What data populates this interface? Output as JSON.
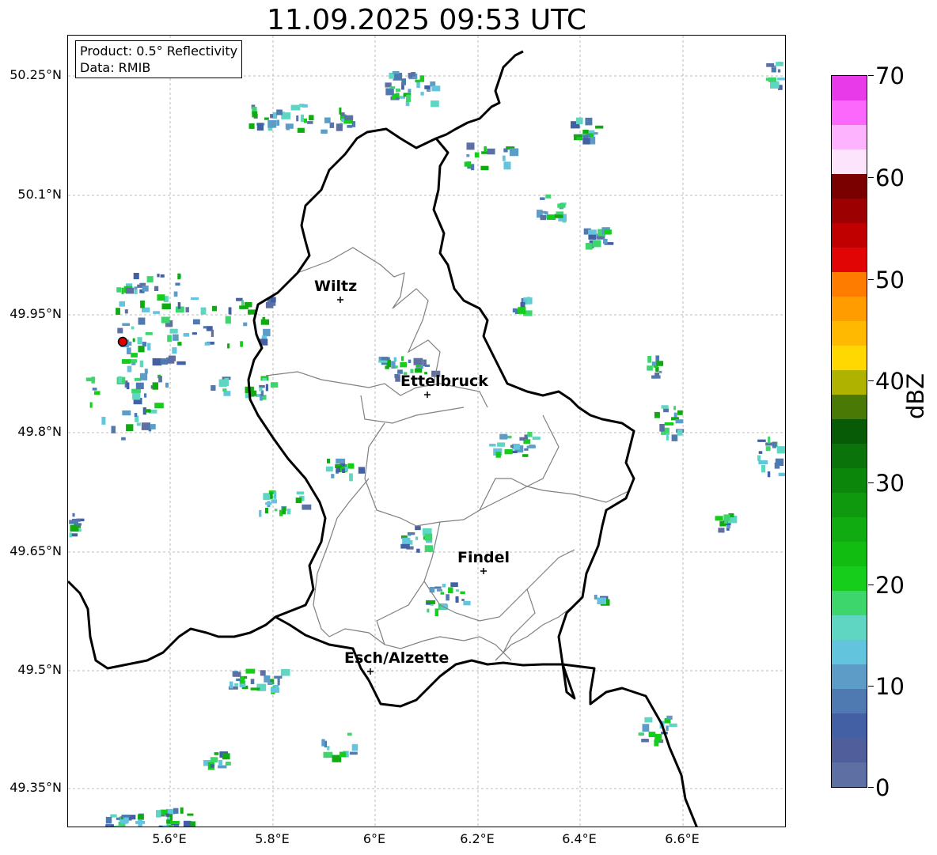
{
  "title": "11.09.2025 09:53 UTC",
  "infobox": {
    "product": "Product: 0.5° Reflectivity",
    "source": "Data: RMIB"
  },
  "axes": {
    "y_labels": [
      "50.25°N",
      "50.1°N",
      "49.95°N",
      "49.8°N",
      "49.65°N",
      "49.5°N",
      "49.35°N"
    ],
    "x_labels": [
      "5.6°E",
      "5.8°E",
      "6°E",
      "6.2°E",
      "6.4°E",
      "6.6°E"
    ]
  },
  "cities": [
    {
      "name": "Wiltz"
    },
    {
      "name": "Ettelbruck"
    },
    {
      "name": "Findel"
    },
    {
      "name": "Esch/Alzette"
    }
  ],
  "colorbar": {
    "unit": "dBZ",
    "tick_labels": [
      "70",
      "60",
      "50",
      "40",
      "30",
      "20",
      "10",
      "0"
    ],
    "colors_top_to_bottom": [
      "#e83ae8",
      "#fb68fb",
      "#feb3fe",
      "#fde4fd",
      "#7a0000",
      "#9d0000",
      "#c00000",
      "#e10505",
      "#fe7d00",
      "#fe9c00",
      "#feb900",
      "#fed800",
      "#b0b200",
      "#4a7906",
      "#075b07",
      "#0a730a",
      "#0b860b",
      "#0f990f",
      "#10ab10",
      "#12bd12",
      "#16cd1b",
      "#3dd66d",
      "#5ed6c2",
      "#63c4de",
      "#5c9cc6",
      "#4f79b1",
      "#4460a4",
      "#505f9b",
      "#5e6fa3"
    ]
  },
  "radar_site": {
    "color": "#e00000"
  }
}
